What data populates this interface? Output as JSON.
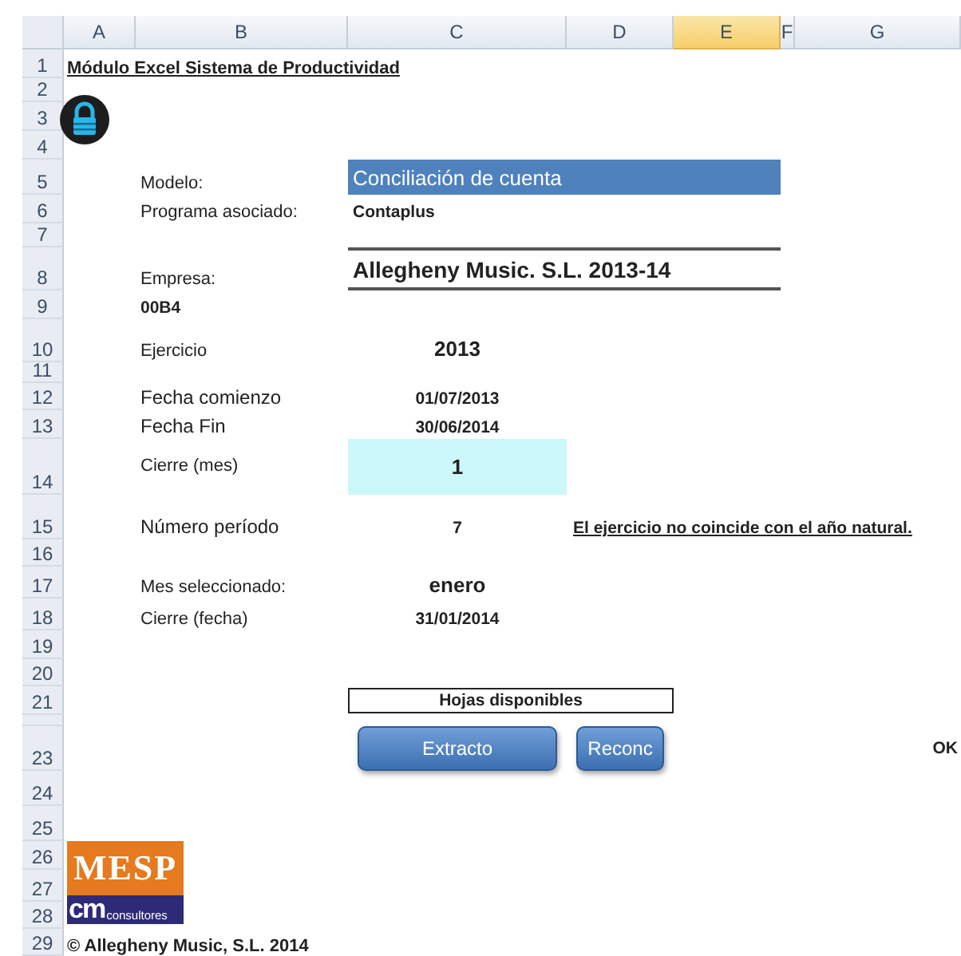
{
  "column_headers": [
    {
      "label": "A",
      "selected": false
    },
    {
      "label": "B",
      "selected": false
    },
    {
      "label": "C",
      "selected": false
    },
    {
      "label": "D",
      "selected": false
    },
    {
      "label": "E",
      "selected": true
    },
    {
      "label": "F",
      "selected": false
    },
    {
      "label": "G",
      "selected": false
    }
  ],
  "row_numbers": [
    "1",
    "2",
    "3",
    "4",
    "5",
    "6",
    "7",
    "8",
    "9",
    "10",
    "11",
    "12",
    "13",
    "14",
    "15",
    "16",
    "17",
    "18",
    "19",
    "20",
    "21",
    "23",
    "24",
    "25",
    "26",
    "27",
    "28",
    "29"
  ],
  "title": "Módulo Excel Sistema de Productividad",
  "modelo": {
    "label": "Modelo:",
    "value": "Conciliación de cuenta"
  },
  "programa": {
    "label": "Programa asociado:",
    "value": "Contaplus"
  },
  "empresa": {
    "label": "Empresa:",
    "value": "Allegheny Music. S.L. 2013-14"
  },
  "codigo": "00B4",
  "ejercicio": {
    "label": "Ejercicio",
    "value": "2013"
  },
  "fecha_comienzo": {
    "label": "Fecha comienzo",
    "value": "01/07/2013"
  },
  "fecha_fin": {
    "label": "Fecha Fin",
    "value": "30/06/2014"
  },
  "cierre_mes": {
    "label": "Cierre (mes)",
    "value": "1"
  },
  "numero_periodo": {
    "label": "Número período",
    "value": "7",
    "note": "El ejercicio no coincide con el año natural."
  },
  "mes_seleccionado": {
    "label": "Mes seleccionado:",
    "value": "enero"
  },
  "cierre_fecha": {
    "label": "Cierre (fecha)",
    "value": "31/01/2014"
  },
  "hojas_disponibles": "Hojas disponibles",
  "buttons": [
    "Extracto",
    "Reconc"
  ],
  "status": "OK",
  "logo": {
    "top": "MESP",
    "mark": "cm",
    "sub": "consultores"
  },
  "copyright": "© Allegheny Music, S.L. 2014"
}
